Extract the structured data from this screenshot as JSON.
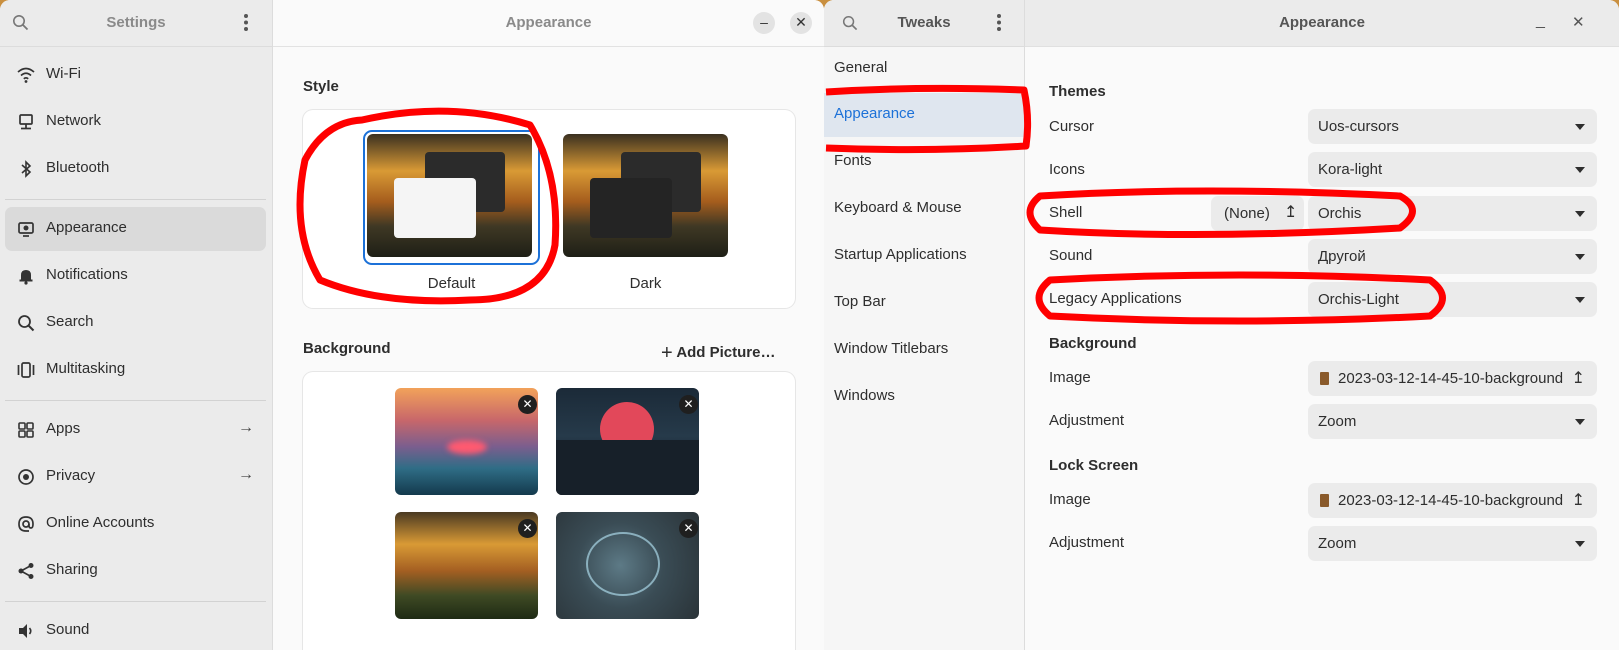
{
  "settings": {
    "sidebar_title": "Settings",
    "main_title": "Appearance",
    "nav": [
      {
        "label": "Wi-Fi",
        "icon": "wifi-icon"
      },
      {
        "label": "Network",
        "icon": "network-icon"
      },
      {
        "label": "Bluetooth",
        "icon": "bluetooth-icon"
      },
      {
        "label": "Appearance",
        "icon": "appearance-icon"
      },
      {
        "label": "Notifications",
        "icon": "bell-icon"
      },
      {
        "label": "Search",
        "icon": "search-icon"
      },
      {
        "label": "Multitasking",
        "icon": "multitasking-icon"
      },
      {
        "label": "Apps",
        "icon": "apps-icon"
      },
      {
        "label": "Privacy",
        "icon": "privacy-icon"
      },
      {
        "label": "Online Accounts",
        "icon": "at-icon"
      },
      {
        "label": "Sharing",
        "icon": "share-icon"
      },
      {
        "label": "Sound",
        "icon": "speaker-icon"
      }
    ],
    "style_section": "Style",
    "style_options": [
      "Default",
      "Dark"
    ],
    "background_section": "Background",
    "add_picture": "Add Picture…"
  },
  "tweaks": {
    "sidebar_title": "Tweaks",
    "main_title": "Appearance",
    "nav": [
      "General",
      "Appearance",
      "Fonts",
      "Keyboard & Mouse",
      "Startup Applications",
      "Top Bar",
      "Window Titlebars",
      "Windows"
    ],
    "themes_section": "Themes",
    "cursor_label": "Cursor",
    "cursor_value": "Uos-cursors",
    "icons_label": "Icons",
    "icons_value": "Kora-light",
    "shell_label": "Shell",
    "shell_none": "(None)",
    "shell_value": "Orchis",
    "sound_label": "Sound",
    "sound_value": "Другой",
    "legacy_label": "Legacy Applications",
    "legacy_value": "Orchis-Light",
    "background_section": "Background",
    "bg_image_label": "Image",
    "bg_image_value": "2023-03-12-14-45-10-background",
    "bg_adjust_label": "Adjustment",
    "bg_adjust_value": "Zoom",
    "lock_section": "Lock Screen",
    "lock_image_label": "Image",
    "lock_image_value": "2023-03-12-14-45-10-background",
    "lock_adjust_label": "Adjustment",
    "lock_adjust_value": "Zoom"
  },
  "colors": {
    "accent": "#1c71d8",
    "annotation": "#ff0000"
  }
}
